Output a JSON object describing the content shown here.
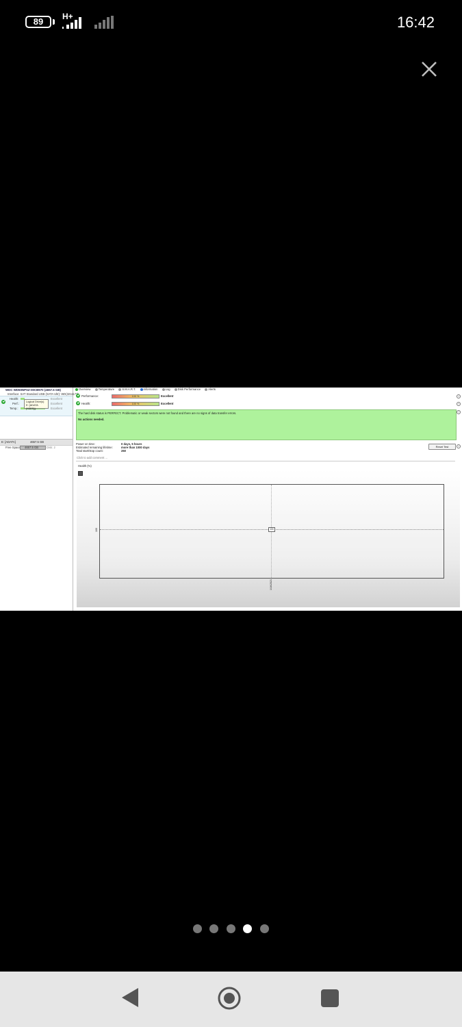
{
  "status_bar": {
    "battery": "89",
    "network": "H+",
    "time": "16:42"
  },
  "viewer": {
    "close_icon": "close-icon",
    "page_dots": [
      {
        "active": false
      },
      {
        "active": false
      },
      {
        "active": false
      },
      {
        "active": true
      },
      {
        "active": false
      }
    ]
  },
  "app": {
    "device": {
      "title": "WDC WD50NPSZ-00CB970 (4657.5 GB)",
      "interface": "Interface: SAT Standard USB (SATA Ultr): WD(3211177)",
      "tooltip_line1": "Logical Drive(s)",
      "tooltip_line2": "E: [ADATA (NTFS)]",
      "health_label": "Health:",
      "perf_label": "Perf.:",
      "temp_label": "Temp.:",
      "temp_value": "40 °C",
      "drive_label": "E:",
      "drive_value": "4657.5 GB",
      "health_status": "Excellent",
      "perf_status": "Excellent",
      "temp_status": "Excellent"
    },
    "volume": {
      "name": "E: [ADATA]",
      "size": "4657.5 GB",
      "free_label": "Free Space:",
      "free_value": "4657.5 GB",
      "free_note": "Disk: 2"
    },
    "tabs": [
      {
        "label": "Overview",
        "icon": "check-icon",
        "color": "#2aa832"
      },
      {
        "label": "Temperature",
        "icon": "thermometer-icon",
        "color": "#999999"
      },
      {
        "label": "S.M.A.R.T.",
        "icon": "smart-icon",
        "color": "#999999"
      },
      {
        "label": "Information",
        "icon": "info-icon",
        "color": "#2a6fd8"
      },
      {
        "label": "Log",
        "icon": "log-icon",
        "color": "#999999"
      },
      {
        "label": "Disk Performance",
        "icon": "performance-icon",
        "color": "#999999"
      },
      {
        "label": "Alerts",
        "icon": "alert-icon",
        "color": "#999999"
      }
    ],
    "performance": {
      "label": "Performance:",
      "value": "100 %",
      "level": 1.0,
      "verdict": "Excellent"
    },
    "health": {
      "label": "Health:",
      "value": "100 %",
      "level": 1.0,
      "verdict": "Excellent"
    },
    "status": {
      "message": "The hard disk status is PERFECT. Problematic or weak sectors were not found and there are no signs of data transfer errors.",
      "action": "No actions needed.",
      "color": "#aef29c"
    },
    "info": {
      "power_on_label": "Power on time:",
      "power_on_value": "0 days, 5 hours",
      "lifetime_label": "Estimated remaining lifetime:",
      "lifetime_value": "more than 1000 days",
      "startstop_label": "Total start/stop count:",
      "startstop_value": "260"
    },
    "reset_label": "Reset Test",
    "comment_placeholder": "Click to add comment ...",
    "chart_title": "Health (%)"
  },
  "chart_data": {
    "type": "line",
    "title": "Health (%)",
    "x": [
      "1/16/2021"
    ],
    "series": [
      {
        "values": [
          100
        ]
      }
    ],
    "ylim": [
      0,
      200
    ],
    "point_labels": [
      "100"
    ],
    "ytick_labels": [
      "100"
    ],
    "xtick_labels": [
      "1/16/2021"
    ],
    "grid": true
  }
}
